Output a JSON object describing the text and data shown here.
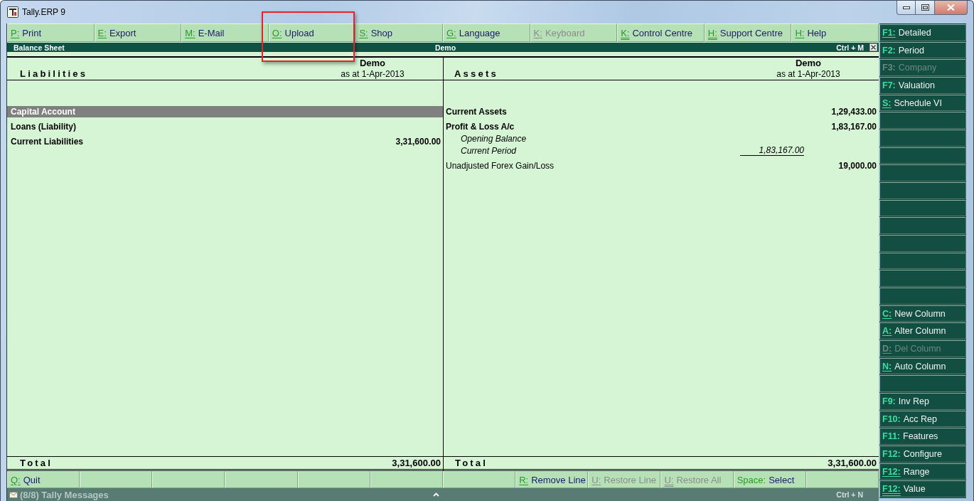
{
  "window": {
    "title": "Tally.ERP 9"
  },
  "top_buttons": [
    {
      "kind": "action",
      "key": "P:",
      "label": "Print",
      "underlined": true,
      "double_underline": false,
      "disabled": false,
      "highlighted": false
    },
    {
      "kind": "action",
      "key": "E:",
      "label": "Export",
      "underlined": true,
      "double_underline": false,
      "disabled": false,
      "highlighted": false
    },
    {
      "kind": "action",
      "key": "M:",
      "label": "E-Mail",
      "underlined": true,
      "double_underline": false,
      "disabled": false,
      "highlighted": false
    },
    {
      "kind": "action",
      "key": "O:",
      "label": "Upload",
      "underlined": true,
      "double_underline": false,
      "disabled": false,
      "highlighted": true
    },
    {
      "kind": "action",
      "key": "S:",
      "label": "Shop",
      "underlined": true,
      "double_underline": false,
      "disabled": false,
      "highlighted": false
    },
    {
      "kind": "action",
      "key": "G:",
      "label": "Language",
      "underlined": true,
      "double_underline": false,
      "disabled": false,
      "highlighted": false
    },
    {
      "kind": "action",
      "key": "K:",
      "label": "Keyboard",
      "underlined": true,
      "double_underline": false,
      "disabled": true,
      "highlighted": false
    },
    {
      "kind": "action",
      "key": "K:",
      "label": "Control Centre",
      "underlined": true,
      "double_underline": true,
      "disabled": false,
      "highlighted": false
    },
    {
      "kind": "action",
      "key": "H:",
      "label": "Support Centre",
      "underlined": true,
      "double_underline": true,
      "disabled": false,
      "highlighted": false
    },
    {
      "kind": "action",
      "key": "H:",
      "label": "Help",
      "underlined": true,
      "double_underline": false,
      "disabled": false,
      "highlighted": false
    }
  ],
  "report": {
    "title": "Balance Sheet",
    "company": "Demo",
    "shortcut": "Ctrl + M"
  },
  "columns": [
    {
      "heading": "Liabilities",
      "company": "Demo",
      "date": "as at 1-Apr-2013",
      "rows": [
        {
          "kind": "group",
          "name": "Capital Account",
          "selected": true
        },
        {
          "kind": "group",
          "name": "Loans (Liability)",
          "selected": false
        },
        {
          "kind": "group",
          "name": "Current Liabilities",
          "amount": "3,31,600.00",
          "selected": false
        }
      ],
      "total_label": "Total",
      "total": "3,31,600.00"
    },
    {
      "heading": "Assets",
      "company": "Demo",
      "date": "as at 1-Apr-2013",
      "rows": [
        {
          "kind": "group",
          "name": "Current Assets",
          "amount": "1,29,433.00",
          "selected": false
        },
        {
          "kind": "group",
          "name": "Profit & Loss A/c",
          "amount": "1,83,167.00",
          "selected": false,
          "children": [
            {
              "name": "Opening Balance"
            },
            {
              "name": "Current Period",
              "amount": "1,83,167.00"
            }
          ]
        },
        {
          "kind": "ledger",
          "name": "Unadjusted Forex Gain/Loss",
          "amount": "19,000.00",
          "selected": false
        }
      ],
      "total_label": "Total",
      "total": "3,31,600.00"
    }
  ],
  "bottom_buttons": [
    {
      "kind": "action",
      "key": "Q:",
      "label": "Quit",
      "underlined": true,
      "double_underline": false,
      "disabled": false
    },
    {
      "kind": "blank"
    },
    {
      "kind": "blank"
    },
    {
      "kind": "blank"
    },
    {
      "kind": "blank"
    },
    {
      "kind": "blank"
    },
    {
      "kind": "blank"
    },
    {
      "kind": "action",
      "key": "R:",
      "label": "Remove Line",
      "underlined": true,
      "double_underline": false,
      "disabled": false
    },
    {
      "kind": "action",
      "key": "U:",
      "label": "Restore Line",
      "underlined": true,
      "double_underline": false,
      "disabled": true
    },
    {
      "kind": "action",
      "key": "U:",
      "label": "Restore All",
      "underlined": true,
      "double_underline": true,
      "disabled": true
    },
    {
      "kind": "action",
      "key": "Space:",
      "label": "Select",
      "underlined": false,
      "double_underline": false,
      "disabled": false
    },
    {
      "kind": "blank"
    }
  ],
  "messages": {
    "title": "(8/8) Tally Messages",
    "shortcut": "Ctrl + N"
  },
  "side_buttons": [
    {
      "kind": "action",
      "key": "F1:",
      "label": "Detailed",
      "underlined": true,
      "double_underline": false,
      "disabled": false
    },
    {
      "kind": "action",
      "key": "F2:",
      "label": "Period",
      "underlined": false,
      "double_underline": false,
      "disabled": false
    },
    {
      "kind": "action",
      "key": "F3:",
      "label": "Company",
      "underlined": false,
      "double_underline": false,
      "disabled": true
    },
    {
      "kind": "action",
      "key": "F7:",
      "label": "Valuation",
      "underlined": false,
      "double_underline": false,
      "disabled": false
    },
    {
      "kind": "action",
      "key": "S:",
      "label": "Schedule VI",
      "underlined": true,
      "double_underline": false,
      "disabled": false
    },
    {
      "kind": "blank"
    },
    {
      "kind": "blank"
    },
    {
      "kind": "blank"
    },
    {
      "kind": "blank"
    },
    {
      "kind": "blank"
    },
    {
      "kind": "blank"
    },
    {
      "kind": "blank"
    },
    {
      "kind": "blank"
    },
    {
      "kind": "blank"
    },
    {
      "kind": "blank"
    },
    {
      "kind": "blank"
    },
    {
      "kind": "action",
      "key": "C:",
      "label": "New Column",
      "underlined": true,
      "double_underline": false,
      "disabled": false
    },
    {
      "kind": "action",
      "key": "A:",
      "label": "Alter Column",
      "underlined": true,
      "double_underline": false,
      "disabled": false
    },
    {
      "kind": "action",
      "key": "D:",
      "label": "Del Column",
      "underlined": true,
      "double_underline": false,
      "disabled": true
    },
    {
      "kind": "action",
      "key": "N:",
      "label": "Auto Column",
      "underlined": true,
      "double_underline": false,
      "disabled": false
    },
    {
      "kind": "blank"
    },
    {
      "kind": "action",
      "key": "F9:",
      "label": "Inv Rep",
      "underlined": false,
      "double_underline": false,
      "disabled": false
    },
    {
      "kind": "action",
      "key": "F10:",
      "label": "Acc Rep",
      "underlined": false,
      "double_underline": false,
      "disabled": false
    },
    {
      "kind": "action",
      "key": "F11:",
      "label": "Features",
      "underlined": false,
      "double_underline": false,
      "disabled": false
    },
    {
      "kind": "action",
      "key": "F12:",
      "label": "Configure",
      "underlined": false,
      "double_underline": false,
      "disabled": false
    },
    {
      "kind": "action",
      "key": "F12:",
      "label": "Range",
      "underlined": true,
      "double_underline": false,
      "disabled": false
    },
    {
      "kind": "action",
      "key": "F12:",
      "label": "Value",
      "underlined": true,
      "double_underline": true,
      "disabled": false
    }
  ]
}
